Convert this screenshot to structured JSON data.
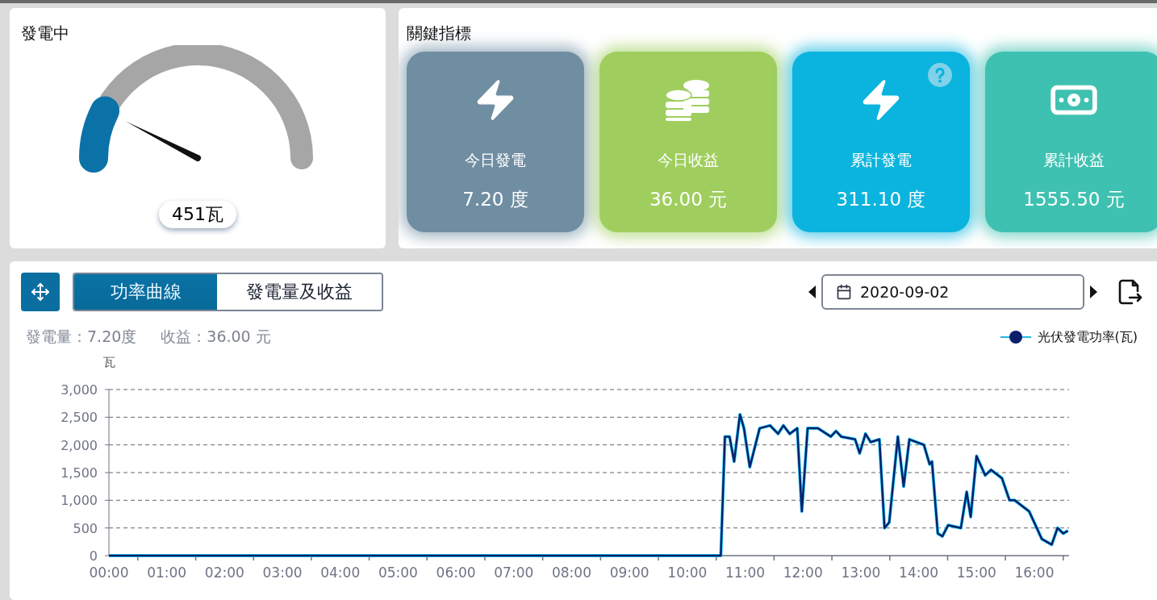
{
  "generating": {
    "title": "發電中",
    "gauge": {
      "level": 0.15,
      "reading": "451瓦"
    }
  },
  "key_metrics": {
    "title": "關鍵指標",
    "cards": [
      {
        "kind": "bolt",
        "color": "#708ea2",
        "label": "今日發電",
        "value": "7.20 度",
        "help": false
      },
      {
        "kind": "coins",
        "color": "#9fce5e",
        "label": "今日收益",
        "value": "36.00 元",
        "help": false
      },
      {
        "kind": "bolt",
        "color": "#0ab4de",
        "label": "累計發電",
        "value": "311.10 度",
        "help": true
      },
      {
        "kind": "cash",
        "color": "#3fc1b1",
        "label": "累計收益",
        "value": "1555.50 元",
        "help": false
      }
    ]
  },
  "chart_panel": {
    "tabs": [
      {
        "label": "功率曲線",
        "selected": true
      },
      {
        "label": "發電量及收益",
        "selected": false
      }
    ],
    "date": "2020-09-02",
    "summary": [
      {
        "label": "發電量：",
        "value": "7.20度"
      },
      {
        "label": "收益：",
        "value": "36.00 元"
      }
    ],
    "chart_data": {
      "type": "line",
      "grid": true,
      "ylabel": "瓦",
      "xlim": [
        0,
        16.6
      ],
      "ylim": [
        0,
        3000
      ],
      "xticks": [
        {
          "value": 0,
          "label": "00:00"
        },
        {
          "value": 1,
          "label": "01:00"
        },
        {
          "value": 2,
          "label": "02:00"
        },
        {
          "value": 3,
          "label": "03:00"
        },
        {
          "value": 4,
          "label": "04:00"
        },
        {
          "value": 5,
          "label": "05:00"
        },
        {
          "value": 6,
          "label": "06:00"
        },
        {
          "value": 7,
          "label": "07:00"
        },
        {
          "value": 8,
          "label": "08:00"
        },
        {
          "value": 9,
          "label": "09:00"
        },
        {
          "value": 10,
          "label": "10:00"
        },
        {
          "value": 11,
          "label": "11:00"
        },
        {
          "value": 12,
          "label": "12:00"
        },
        {
          "value": 13,
          "label": "13:00"
        },
        {
          "value": 14,
          "label": "14:00"
        },
        {
          "value": 15,
          "label": "15:00"
        },
        {
          "value": 16,
          "label": "16:00"
        }
      ],
      "yticks": [
        {
          "value": 0,
          "label": "0"
        },
        {
          "value": 500,
          "label": "500"
        },
        {
          "value": 1000,
          "label": "1,000"
        },
        {
          "value": 1500,
          "label": "1,500"
        },
        {
          "value": 2000,
          "label": "2,000"
        },
        {
          "value": 2500,
          "label": "2,500"
        },
        {
          "value": 3000,
          "label": "3,000"
        }
      ],
      "x": [
        0,
        10.39,
        10.58,
        10.65,
        10.73,
        10.81,
        10.91,
        10.98,
        11.08,
        11.25,
        11.43,
        11.57,
        11.66,
        11.77,
        11.9,
        11.98,
        12.08,
        12.26,
        12.48,
        12.57,
        12.66,
        12.9,
        12.98,
        13.08,
        13.17,
        13.32,
        13.41,
        13.49,
        13.64,
        13.74,
        13.84,
        14.09,
        14.19,
        14.23,
        14.33,
        14.41,
        14.51,
        14.73,
        14.83,
        14.9,
        15.0,
        15.15,
        15.25,
        15.44,
        15.57,
        15.66,
        15.91,
        16.13,
        16.3,
        16.4,
        16.5,
        16.58
      ],
      "series": [
        {
          "name": "光伏發電功率(瓦)",
          "color": "#0b1f6b",
          "values": [
            0,
            0,
            0,
            2150,
            2150,
            1700,
            2550,
            2300,
            1600,
            2300,
            2350,
            2200,
            2350,
            2200,
            2300,
            800,
            2300,
            2300,
            2150,
            2250,
            2150,
            2100,
            1850,
            2200,
            2050,
            2100,
            500,
            600,
            2150,
            1250,
            2100,
            2000,
            1650,
            1700,
            400,
            350,
            550,
            500,
            1150,
            700,
            1800,
            1450,
            1550,
            1400,
            1000,
            1000,
            800,
            300,
            200,
            500,
            400,
            450
          ]
        }
      ]
    }
  }
}
